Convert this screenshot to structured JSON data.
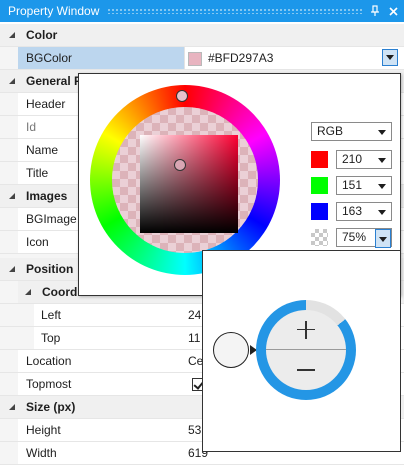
{
  "window": {
    "title": "Property Window",
    "pin_icon": "pin-icon",
    "close_icon": "close-icon",
    "accent": "#1c97ea"
  },
  "grid": {
    "rows": [
      {
        "kind": "category",
        "label": "Color"
      },
      {
        "kind": "property",
        "label": "BGColor",
        "value": "#BFD297A3",
        "selected": true
      },
      {
        "kind": "category",
        "label": "General F"
      },
      {
        "kind": "property",
        "label": "Header",
        "value": ""
      },
      {
        "kind": "property",
        "label": "Id",
        "value": "",
        "dim": true
      },
      {
        "kind": "property",
        "label": "Name",
        "value": ""
      },
      {
        "kind": "property",
        "label": "Title",
        "value": ""
      },
      {
        "kind": "category",
        "label": "Images"
      },
      {
        "kind": "property",
        "label": "BGImage",
        "value": ""
      },
      {
        "kind": "property",
        "label": "Icon",
        "value": ""
      },
      {
        "kind": "category",
        "label": "Position"
      },
      {
        "kind": "subcategory",
        "label": "Coordi"
      },
      {
        "kind": "property",
        "label": "Left",
        "value": "24",
        "deep": true
      },
      {
        "kind": "property",
        "label": "Top",
        "value": "11",
        "deep": true
      },
      {
        "kind": "property",
        "label": "Location",
        "value": "Ce"
      },
      {
        "kind": "property",
        "label": "Topmost",
        "value": "checked"
      },
      {
        "kind": "category",
        "label": "Size (px)"
      },
      {
        "kind": "property",
        "label": "Height",
        "value": "53"
      },
      {
        "kind": "property",
        "label": "Width",
        "value": "619"
      }
    ]
  },
  "color_picker": {
    "hex": "#BFD297A3",
    "model": "RGB",
    "channels": [
      {
        "name": "red",
        "value": "210",
        "color": "#ff0000"
      },
      {
        "name": "green",
        "value": "151",
        "color": "#00ff00"
      },
      {
        "name": "blue",
        "value": "163",
        "color": "#0000ff"
      }
    ],
    "alpha": "75%",
    "swatch_color": "#d297a3"
  },
  "spinner": {
    "increment_icon": "plus-icon",
    "decrement_icon": "minus-icon",
    "value_fraction": 0.86,
    "ring_color": "#2496e5"
  }
}
